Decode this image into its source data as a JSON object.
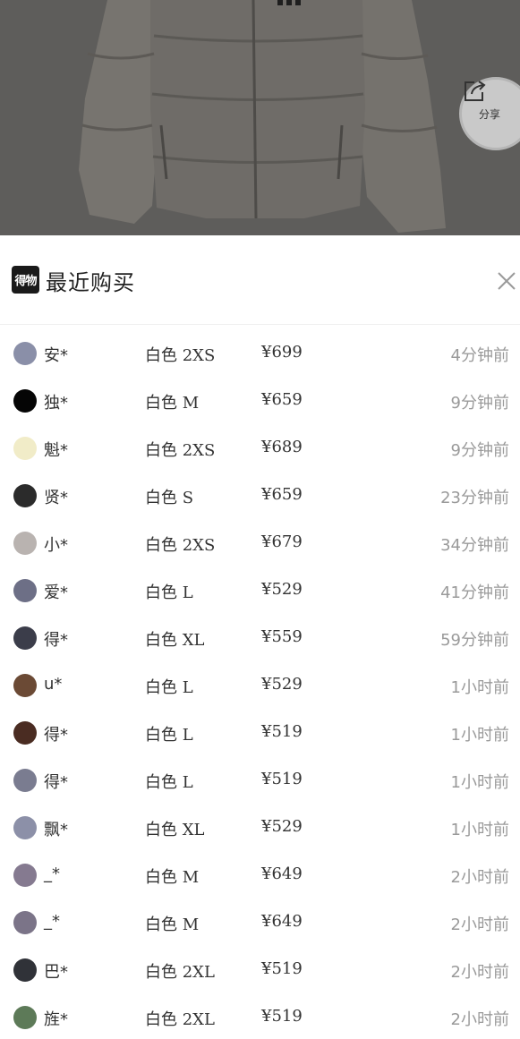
{
  "share": {
    "label": "分享"
  },
  "sheet": {
    "brand": "得物",
    "title": "最近购买"
  },
  "rows": [
    {
      "name": "安*",
      "spec": "白色 2XS",
      "price": "¥699",
      "time": "4分钟前",
      "avatar_color": "#8a8fa8"
    },
    {
      "name": "独*",
      "spec": "白色 M",
      "price": "¥659",
      "time": "9分钟前",
      "avatar_color": "#050505"
    },
    {
      "name": "魁*",
      "spec": "白色 2XS",
      "price": "¥689",
      "time": "9分钟前",
      "avatar_color": "#f1ecc8"
    },
    {
      "name": "贤*",
      "spec": "白色 S",
      "price": "¥659",
      "time": "23分钟前",
      "avatar_color": "#2b2b2b"
    },
    {
      "name": "小*",
      "spec": "白色 2XS",
      "price": "¥679",
      "time": "34分钟前",
      "avatar_color": "#b9b3b0"
    },
    {
      "name": "爱*",
      "spec": "白色 L",
      "price": "¥529",
      "time": "41分钟前",
      "avatar_color": "#6d6f86"
    },
    {
      "name": "得*",
      "spec": "白色 XL",
      "price": "¥559",
      "time": "59分钟前",
      "avatar_color": "#3b3d4a"
    },
    {
      "name": "u*",
      "spec": "白色 L",
      "price": "¥529",
      "time": "1小时前",
      "avatar_color": "#6b4a35"
    },
    {
      "name": "得*",
      "spec": "白色 L",
      "price": "¥519",
      "time": "1小时前",
      "avatar_color": "#4a2c22"
    },
    {
      "name": "得*",
      "spec": "白色 L",
      "price": "¥519",
      "time": "1小时前",
      "avatar_color": "#7a7c90"
    },
    {
      "name": "飘*",
      "spec": "白色 XL",
      "price": "¥529",
      "time": "1小时前",
      "avatar_color": "#8c90a8"
    },
    {
      "name": "_*",
      "spec": "白色 M",
      "price": "¥649",
      "time": "2小时前",
      "avatar_color": "#857a90"
    },
    {
      "name": "_*",
      "spec": "白色 M",
      "price": "¥649",
      "time": "2小时前",
      "avatar_color": "#7b7488"
    },
    {
      "name": "巴*",
      "spec": "白色 2XL",
      "price": "¥519",
      "time": "2小时前",
      "avatar_color": "#303238"
    },
    {
      "name": "旌*",
      "spec": "白色 2XL",
      "price": "¥519",
      "time": "2小时前",
      "avatar_color": "#5d7a58"
    }
  ]
}
